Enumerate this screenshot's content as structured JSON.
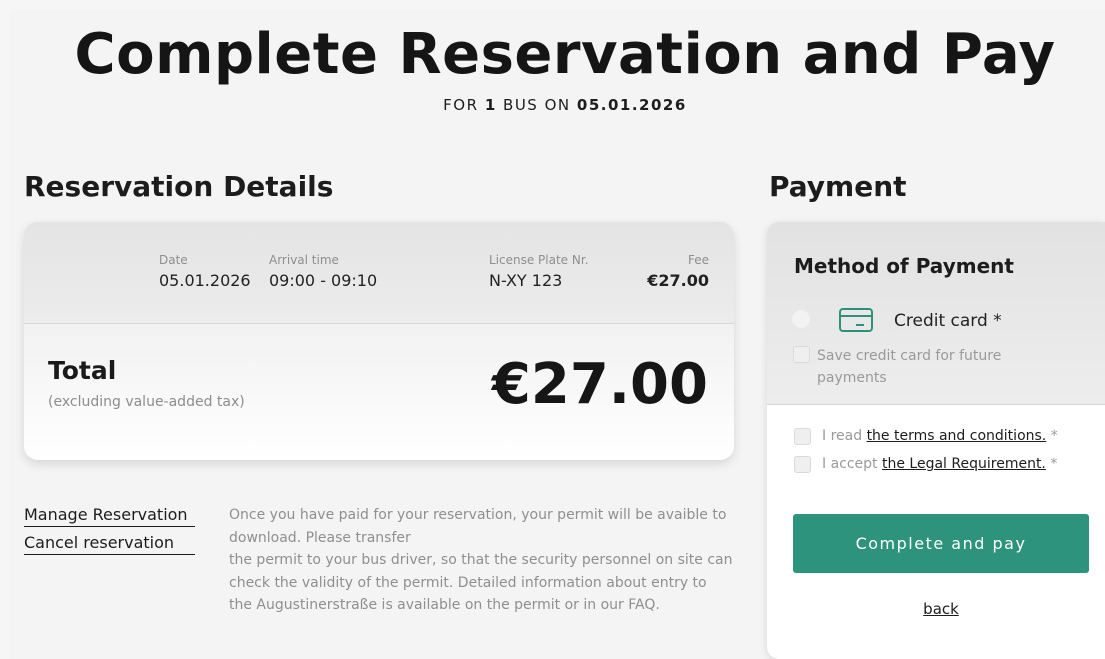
{
  "header": {
    "title": "Complete Reservation and Pay",
    "subtitle_prefix": "FOR",
    "bus_count": "1",
    "subtitle_mid": "BUS ON",
    "date": "05.01.2026"
  },
  "reservation": {
    "heading": "Reservation Details",
    "columns": [
      {
        "label": "Date",
        "value": "05.01.2026"
      },
      {
        "label": "Arrival time",
        "value": "09:00 - 09:10"
      },
      {
        "label": "License Plate Nr.",
        "value": "N-XY 123"
      },
      {
        "label": "Fee",
        "value": "€27.00"
      }
    ],
    "total_label": "Total",
    "total_note": "(excluding value-added tax)",
    "total_amount": "€27.00"
  },
  "links": {
    "manage": "Manage Reservation",
    "cancel": "Cancel reservation"
  },
  "info": {
    "line1": "Once you have paid for your reservation, your permit will be avaible to download. Please transfer",
    "line2": "the permit to your bus driver, so that the security personnel on site can check the validity of the permit. Detailed information about entry to the Augustinerstraße is available on the permit or in our FAQ."
  },
  "payment": {
    "heading": "Payment",
    "method_heading": "Method of Payment",
    "credit_card_label": "Credit card *",
    "card_icon": "credit-card-icon",
    "save_card_label": "Save credit card for future payments",
    "terms_prefix": "I read",
    "terms_link": "the terms and conditions.",
    "terms_req": "*",
    "legal_prefix": "I accept",
    "legal_link": "the Legal Requirement.",
    "legal_req": "*",
    "pay_button": "Complete and pay",
    "back_link": "back",
    "accent_color": "#2e937c"
  }
}
